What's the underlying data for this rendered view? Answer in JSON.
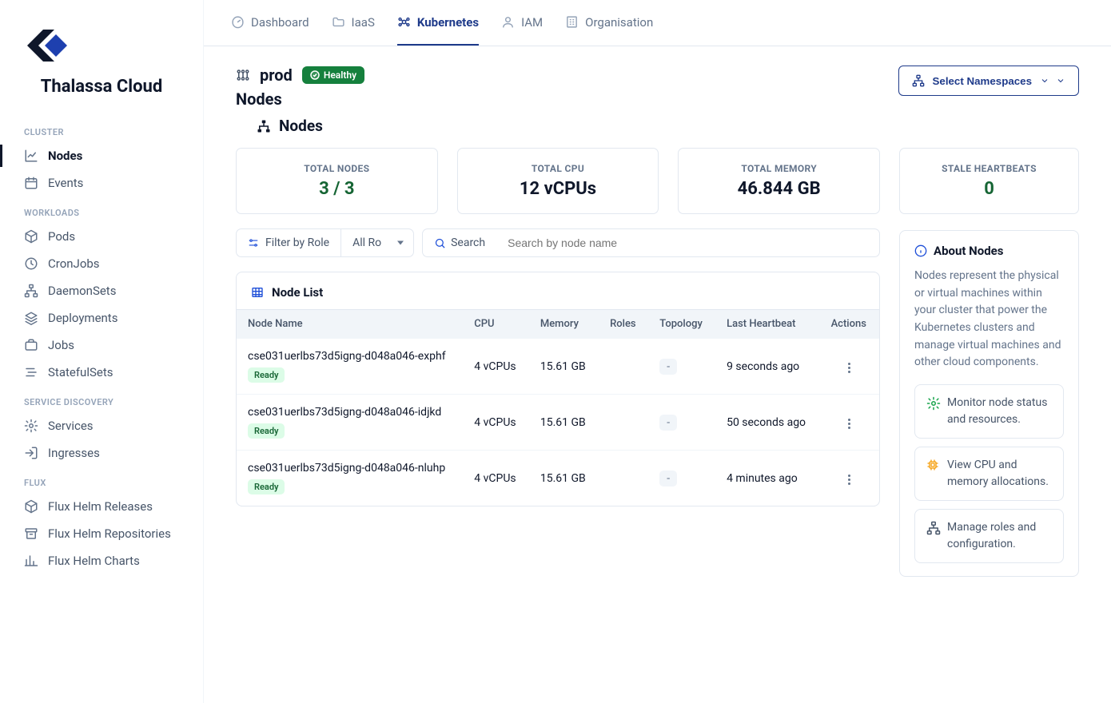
{
  "brand": {
    "name": "Thalassa Cloud"
  },
  "topnav": {
    "items": [
      {
        "label": "Dashboard"
      },
      {
        "label": "IaaS"
      },
      {
        "label": "Kubernetes"
      },
      {
        "label": "IAM"
      },
      {
        "label": "Organisation"
      }
    ],
    "activeIndex": 2
  },
  "sidebar": {
    "sections": [
      {
        "label": "CLUSTER",
        "items": [
          {
            "label": "Nodes",
            "icon": "line-chart"
          },
          {
            "label": "Events",
            "icon": "calendar"
          }
        ],
        "activeIndex": 0
      },
      {
        "label": "WORKLOADS",
        "items": [
          {
            "label": "Pods",
            "icon": "cube"
          },
          {
            "label": "CronJobs",
            "icon": "clock"
          },
          {
            "label": "DaemonSets",
            "icon": "sitemap"
          },
          {
            "label": "Deployments",
            "icon": "layers"
          },
          {
            "label": "Jobs",
            "icon": "briefcase"
          },
          {
            "label": "StatefulSets",
            "icon": "bars-staggered"
          }
        ]
      },
      {
        "label": "SERVICE DISCOVERY",
        "items": [
          {
            "label": "Services",
            "icon": "gear"
          },
          {
            "label": "Ingresses",
            "icon": "enter"
          }
        ]
      },
      {
        "label": "FLUX",
        "items": [
          {
            "label": "Flux Helm Releases",
            "icon": "cube"
          },
          {
            "label": "Flux Helm Repositories",
            "icon": "archive"
          },
          {
            "label": "Flux Helm Charts",
            "icon": "bar-chart"
          }
        ]
      }
    ]
  },
  "cluster": {
    "name": "prod",
    "healthLabel": "Healthy",
    "nsButton": "Select Namespaces"
  },
  "pageTitle": "Nodes",
  "sectionTitle": "Nodes",
  "stats": [
    {
      "label": "TOTAL NODES",
      "value": "3 / 3",
      "green": true
    },
    {
      "label": "TOTAL CPU",
      "value": "12 vCPUs",
      "green": false
    },
    {
      "label": "TOTAL MEMORY",
      "value": "46.844 GB",
      "green": false
    },
    {
      "label": "STALE HEARTBEATS",
      "value": "0",
      "green": true
    }
  ],
  "filters": {
    "roleLabel": "Filter by Role",
    "roleValue": "All Ro",
    "searchButton": "Search",
    "searchPlaceholder": "Search by node name"
  },
  "table": {
    "title": "Node List",
    "columns": [
      "Node Name",
      "CPU",
      "Memory",
      "Roles",
      "Topology",
      "Last Heartbeat",
      "Actions"
    ],
    "rows": [
      {
        "name": "cse031uerlbs73d5igng-d048a046-exphf",
        "status": "Ready",
        "cpu": "4 vCPUs",
        "memory": "15.61 GB",
        "roles": "",
        "topology": "-",
        "heartbeat": "9 seconds ago"
      },
      {
        "name": "cse031uerlbs73d5igng-d048a046-idjkd",
        "status": "Ready",
        "cpu": "4 vCPUs",
        "memory": "15.61 GB",
        "roles": "",
        "topology": "-",
        "heartbeat": "50 seconds ago"
      },
      {
        "name": "cse031uerlbs73d5igng-d048a046-nluhp",
        "status": "Ready",
        "cpu": "4 vCPUs",
        "memory": "15.61 GB",
        "roles": "",
        "topology": "-",
        "heartbeat": "4 minutes ago"
      }
    ]
  },
  "about": {
    "title": "About Nodes",
    "text": "Nodes represent the physical or virtual machines within your cluster that power the Kubernetes clusters and manage virtual machines and other cloud components.",
    "tips": [
      {
        "icon": "gear",
        "color": "#16a34a",
        "text": "Monitor node status and resources."
      },
      {
        "icon": "chip",
        "color": "#f59e0b",
        "text": "View CPU and memory allocations."
      },
      {
        "icon": "sitemap",
        "color": "#475569",
        "text": "Manage roles and configuration."
      }
    ]
  }
}
